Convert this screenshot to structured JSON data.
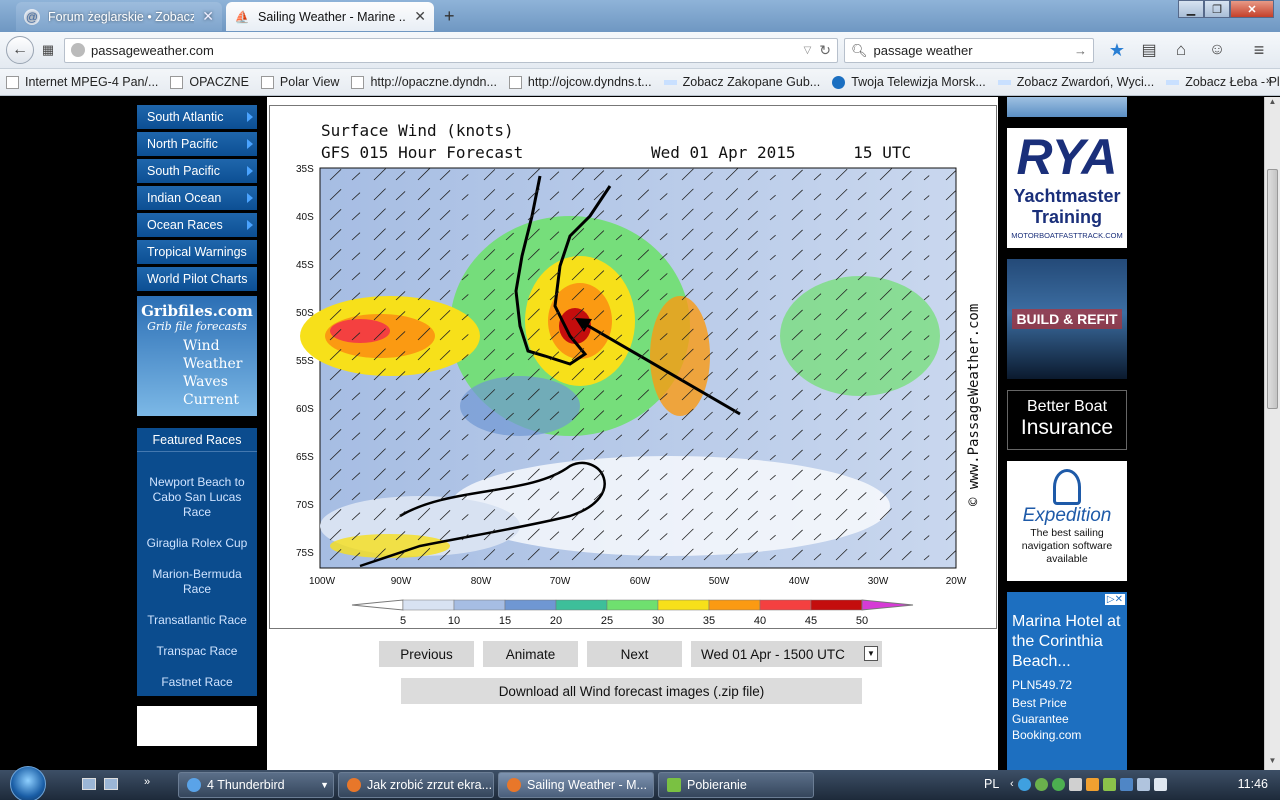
{
  "browser": {
    "tabs": [
      {
        "label": "Forum żeglarskie • Zobacz ..."
      },
      {
        "label": "Sailing Weather - Marine ..."
      }
    ],
    "url": "passageweather.com",
    "search_value": "passage weather",
    "bookmarks": [
      "Internet MPEG-4 Pan/...",
      "OPACZNE",
      "Polar View",
      "http://opaczne.dyndn...",
      "http://ojcow.dyndns.t...",
      "Zobacz Zakopane Gub...",
      "Twoja Telewizja Morsk...",
      "Zobacz Zwardoń, Wyci...",
      "Zobacz Łeba - Plaża, A..."
    ]
  },
  "sidebar": {
    "menu": [
      {
        "label": "South Atlantic",
        "arrow": true
      },
      {
        "label": "North Pacific",
        "arrow": true
      },
      {
        "label": "South Pacific",
        "arrow": true
      },
      {
        "label": "Indian Ocean",
        "arrow": true
      },
      {
        "label": "Ocean Races",
        "arrow": true
      },
      {
        "label": "Tropical Warnings",
        "arrow": false
      },
      {
        "label": "World Pilot Charts",
        "arrow": false
      }
    ],
    "gribfiles": {
      "title": "Gribfiles.com",
      "subtitle": "Grib file forecasts",
      "lines": [
        "Wind",
        "Weather",
        "Waves",
        "Current"
      ]
    },
    "featured": {
      "title": "Featured Races",
      "races": [
        "Newport Beach to Cabo San Lucas Race",
        "Giraglia Rolex Cup",
        "Marion-Bermuda Race",
        "Transatlantic Race",
        "Transpac Race",
        "Fastnet Race"
      ]
    }
  },
  "map": {
    "title_line1": "Surface Wind (knots)",
    "title_line2_left": "GFS 015 Hour Forecast",
    "title_line2_right": "Wed 01 Apr 2015      15 UTC",
    "watermark": "© www.PassageWeather.com",
    "lat_labels": [
      "35S",
      "40S",
      "45S",
      "50S",
      "55S",
      "60S",
      "65S",
      "70S",
      "75S"
    ],
    "lon_labels": [
      "100W",
      "90W",
      "80W",
      "70W",
      "60W",
      "50W",
      "40W",
      "30W",
      "20W"
    ],
    "scale_values": [
      "5",
      "10",
      "15",
      "20",
      "25",
      "30",
      "35",
      "40",
      "45",
      "50"
    ],
    "scale_colors": [
      "#ffffff",
      "#d8e2f2",
      "#a6bde3",
      "#6f97d3",
      "#3dbf9a",
      "#6fe06f",
      "#f7e01a",
      "#fb9a12",
      "#f44040",
      "#c40d0d",
      "#d63bd6"
    ]
  },
  "controls": {
    "previous": "Previous",
    "animate": "Animate",
    "next": "Next",
    "select_value": "Wed 01 Apr - 1500 UTC",
    "download": "Download all Wind forecast images (.zip file)"
  },
  "ads": {
    "rya": {
      "title": "RYA",
      "line1": "Yachtmaster",
      "line2": "Training",
      "footer": "MOTORBOATFASTTRACK.COM"
    },
    "build": {
      "text": "BUILD & REFIT"
    },
    "insurance": {
      "line1": "Better Boat",
      "line2": "Insurance"
    },
    "expedition": {
      "title": "Expedition",
      "text": "The best sailing navigation software available"
    },
    "marina": {
      "title": "Marina Hotel at the Corinthia Beach...",
      "price": "PLN549.72",
      "line1": "Best Price",
      "line2": "Guarantee",
      "site": "Booking.com"
    }
  },
  "taskbar": {
    "items": [
      "4 Thunderbird",
      "Jak zrobić zrzut ekra...",
      "Sailing Weather - M...",
      "Pobieranie"
    ],
    "lang": "PL",
    "clock": "11:46"
  }
}
